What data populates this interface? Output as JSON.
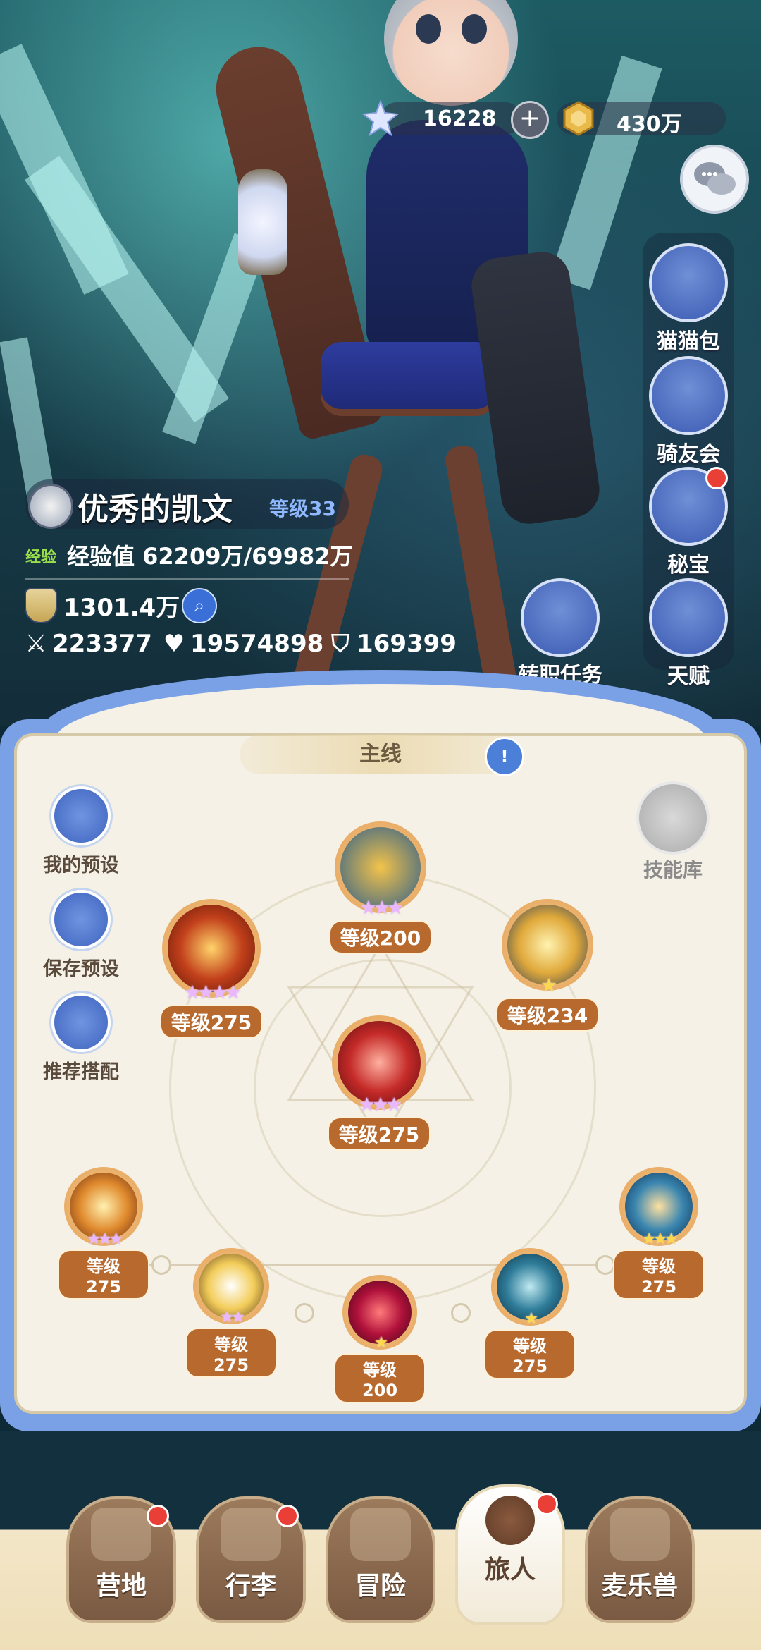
{
  "currency": {
    "gems": "16228",
    "gems_icon": "star-crystal-icon",
    "plus_label": "+",
    "coins": "430万",
    "coins_icon": "gold-coin-icon"
  },
  "side": {
    "chat_icon": "chat-bubble-icon",
    "buttons": [
      {
        "label": "猫猫包",
        "icon": "cat-bag-icon",
        "badge": false
      },
      {
        "label": "骑友会",
        "icon": "horse-icon",
        "badge": false
      },
      {
        "label": "秘宝",
        "icon": "treasure-icon",
        "badge": true
      },
      {
        "label": "天赋",
        "icon": "brain-head-icon",
        "badge": false
      }
    ]
  },
  "player": {
    "name": "优秀的凯文",
    "level": "等级33",
    "exp_tag": "经验",
    "exp_text": "经验值 62209万/69982万",
    "power": "1301.4万",
    "attack": "223377",
    "hp": "19574898",
    "defense": "169399"
  },
  "job_task": {
    "label": "转职任务"
  },
  "skills_panel": {
    "mainline": "主线",
    "mainline_icon": "!",
    "left_buttons": [
      {
        "label": "我的预设",
        "icon": "cards-icon"
      },
      {
        "label": "保存预设",
        "icon": "floppy-disk-icon"
      },
      {
        "label": "推荐搭配",
        "icon": "recommend-icon"
      }
    ],
    "skill_library": "技能库",
    "skills": [
      {
        "level": "等级200",
        "stars": "★★★",
        "star_color": "purple"
      },
      {
        "level": "等级275",
        "stars": "★★★★",
        "star_color": "purple"
      },
      {
        "level": "等级234",
        "stars": "★",
        "star_color": "gold"
      },
      {
        "level": "等级275",
        "stars": "★★★",
        "star_color": "purple"
      },
      {
        "level": "等级275",
        "stars": "★★★",
        "star_color": "purple"
      },
      {
        "level": "等级275",
        "stars": "★★",
        "star_color": "purple"
      },
      {
        "level": "等级200",
        "stars": "★",
        "star_color": "gold"
      },
      {
        "level": "等级275",
        "stars": "★",
        "star_color": "gold"
      },
      {
        "level": "等级275",
        "stars": "★★★",
        "star_color": "gold"
      }
    ]
  },
  "nav": {
    "tabs": [
      {
        "label": "营地",
        "icon": "castle-icon",
        "badge": true,
        "active": false
      },
      {
        "label": "行李",
        "icon": "backpack-icon",
        "badge": true,
        "active": false
      },
      {
        "label": "冒险",
        "icon": "crossed-swords-icon",
        "badge": false,
        "active": false
      },
      {
        "label": "旅人",
        "icon": "traveler-portrait-icon",
        "badge": true,
        "active": true
      },
      {
        "label": "麦乐兽",
        "icon": "cat-face-icon",
        "badge": false,
        "active": false
      }
    ]
  },
  "colors": {
    "accent_blue": "#7aa0e6",
    "panel_bg": "#f5f1e6",
    "level_badge": "#b86a2e",
    "badge_red": "#ea3f36"
  }
}
